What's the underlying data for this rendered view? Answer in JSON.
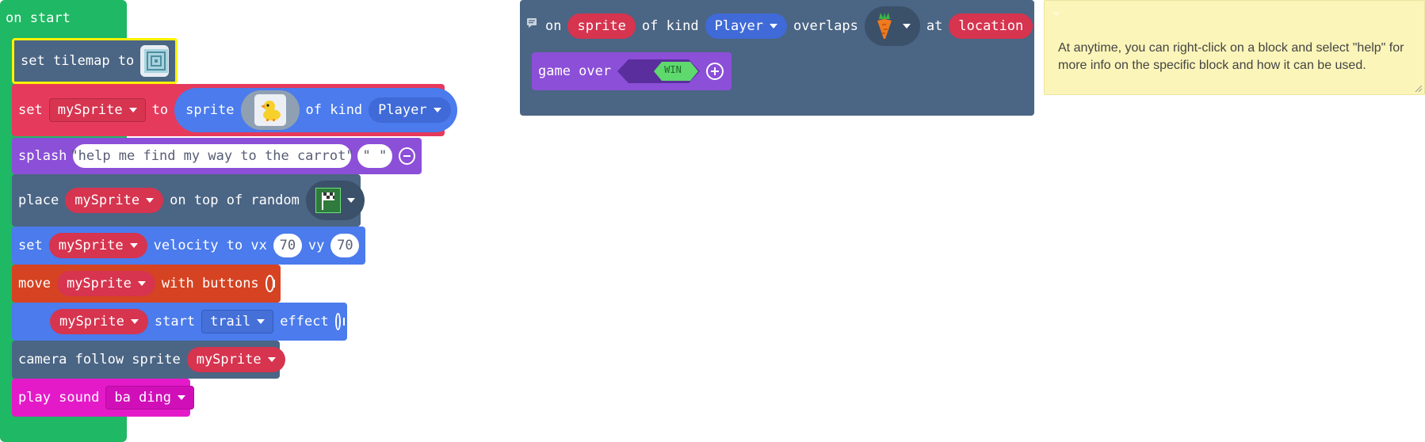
{
  "on_start": {
    "label": "on start",
    "set_tilemap": {
      "label": "set tilemap to"
    },
    "set_sprite": {
      "set": "set",
      "variable": "mySprite",
      "to": "to",
      "sprite": "sprite",
      "of_kind": "of kind",
      "kind": "Player"
    },
    "splash": {
      "label": "splash",
      "text1": "\"help me find my way to the carrot\"",
      "text2": "\" \""
    },
    "place": {
      "label": "place",
      "variable": "mySprite",
      "on_top": "on top of random"
    },
    "velocity": {
      "set": "set",
      "variable": "mySprite",
      "label": "velocity to vx",
      "vx": "70",
      "vy_label": "vy",
      "vy": "70"
    },
    "move": {
      "label": "move",
      "variable": "mySprite",
      "with_buttons": "with buttons"
    },
    "effect": {
      "variable": "mySprite",
      "start": "start",
      "effect": "trail",
      "effect_label": "effect"
    },
    "camera": {
      "label": "camera follow sprite",
      "variable": "mySprite"
    },
    "sound": {
      "label": "play sound",
      "sound": "ba ding"
    }
  },
  "overlap_event": {
    "on": "on",
    "sprite": "sprite",
    "of_kind": "of kind",
    "kind": "Player",
    "overlaps": "overlaps",
    "at": "at",
    "location": "location",
    "game_over": "game over",
    "win": "WIN"
  },
  "comment": {
    "text": "At anytime, you can right-click on a block and select \"help\" for more info on the specific block and how it can be used."
  },
  "colors": {
    "event_green": "#1fb864",
    "scene_blue": "#4b6584",
    "sprite_red": "#e63a5c",
    "variable_red": "#d6344f",
    "splash_purple": "#8c4fd8",
    "motion_blue": "#4b7bec",
    "controller_orange": "#d54322",
    "music_magenta": "#e41ac9",
    "comment_yellow": "#fbf5b9",
    "selection_yellow": "#fff200"
  }
}
